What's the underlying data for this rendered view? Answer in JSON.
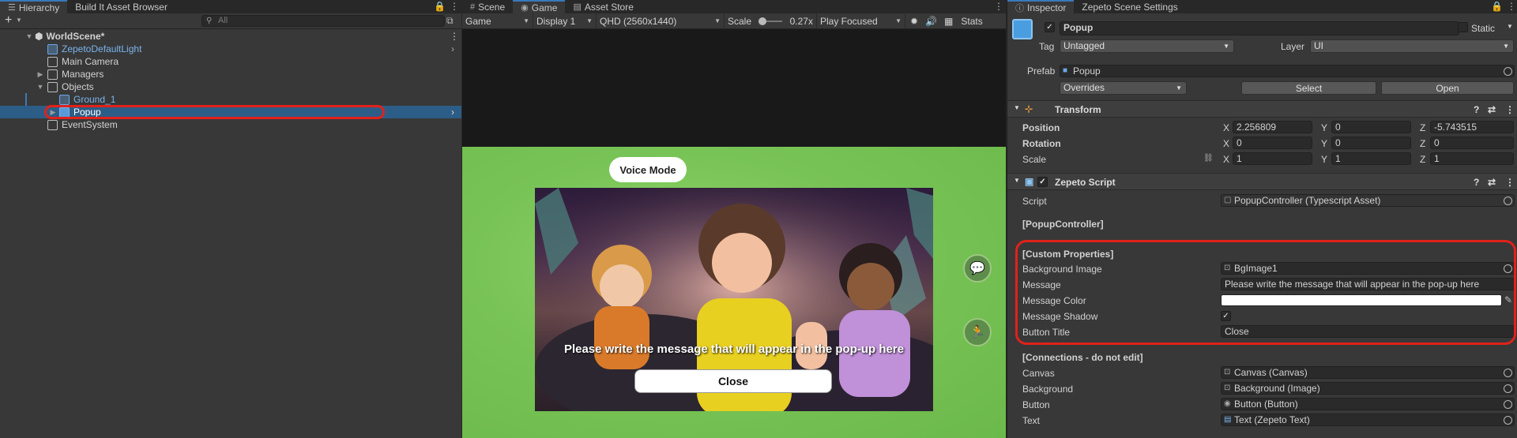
{
  "hierarchy": {
    "tabs": [
      {
        "label": "Hierarchy",
        "active": true
      },
      {
        "label": "Build It Asset Browser",
        "active": false
      }
    ],
    "search_placeholder": "All",
    "add_label": "+",
    "items": [
      {
        "label": "WorldScene*",
        "expanded": true,
        "type": "scene"
      },
      {
        "label": "ZepetoDefaultLight",
        "type": "prefab"
      },
      {
        "label": "Main Camera",
        "type": "object"
      },
      {
        "label": "Managers",
        "type": "object",
        "collapsed": true
      },
      {
        "label": "Objects",
        "type": "object",
        "expanded": true
      },
      {
        "label": "Ground_1",
        "type": "prefab"
      },
      {
        "label": "Popup",
        "type": "prefab",
        "selected": true
      },
      {
        "label": "EventSystem",
        "type": "object"
      }
    ]
  },
  "game": {
    "tabs": [
      {
        "label": "Scene",
        "icon": "grid-icon"
      },
      {
        "label": "Game",
        "icon": "gamepad-icon",
        "active": true
      },
      {
        "label": "Asset Store",
        "icon": "store-icon"
      }
    ],
    "toolbar": {
      "view": "Game",
      "display": "Display 1",
      "resolution": "QHD (2560x1440)",
      "scale_label": "Scale",
      "scale_value": "0.27x",
      "play_mode": "Play Focused",
      "stats": "Stats"
    },
    "viewport": {
      "voice_mode": "Voice Mode",
      "popup_message": "Please write the message that will appear in the pop-up here",
      "close_button": "Close"
    }
  },
  "inspector": {
    "tabs": [
      {
        "label": "Inspector",
        "active": true
      },
      {
        "label": "Zepeto Scene Settings",
        "active": false
      }
    ],
    "object_name": "Popup",
    "static_label": "Static",
    "tag_label": "Tag",
    "tag_value": "Untagged",
    "layer_label": "Layer",
    "layer_value": "UI",
    "prefab_label": "Prefab",
    "prefab_value": "Popup",
    "overrides": "Overrides",
    "select": "Select",
    "open": "Open",
    "transform": {
      "title": "Transform",
      "position_label": "Position",
      "rotation_label": "Rotation",
      "scale_label": "Scale",
      "position": {
        "x": "2.256809",
        "y": "0",
        "z": "-5.743515"
      },
      "rotation": {
        "x": "0",
        "y": "0",
        "z": "0"
      },
      "scale": {
        "x": "1",
        "y": "1",
        "z": "1"
      },
      "axis": {
        "x": "X",
        "y": "Y",
        "z": "Z"
      }
    },
    "zepeto_script": {
      "title": "Zepeto Script",
      "script_label": "Script",
      "script_value": "PopupController (Typescript Asset)",
      "class_header": "[PopupController]",
      "custom_header": "[Custom Properties]",
      "props": [
        {
          "label": "Background Image",
          "value": "BgImage1"
        },
        {
          "label": "Message",
          "value": "Please write the message that will appear in the pop-up here"
        },
        {
          "label": "Message Color",
          "value": ""
        },
        {
          "label": "Message Shadow",
          "value": "✓"
        },
        {
          "label": "Button Title",
          "value": "Close"
        }
      ],
      "connections_header": "[Connections - do not edit]",
      "connections": [
        {
          "label": "Canvas",
          "value": "Canvas (Canvas)"
        },
        {
          "label": "Background",
          "value": "Background (Image)"
        },
        {
          "label": "Button",
          "value": "Button (Button)"
        },
        {
          "label": "Text",
          "value": "Text (Zepeto Text)"
        }
      ]
    }
  },
  "colors": {
    "accent": "#2c5d87",
    "highlight": "#e0221b",
    "viewport_green": "#78c356"
  }
}
